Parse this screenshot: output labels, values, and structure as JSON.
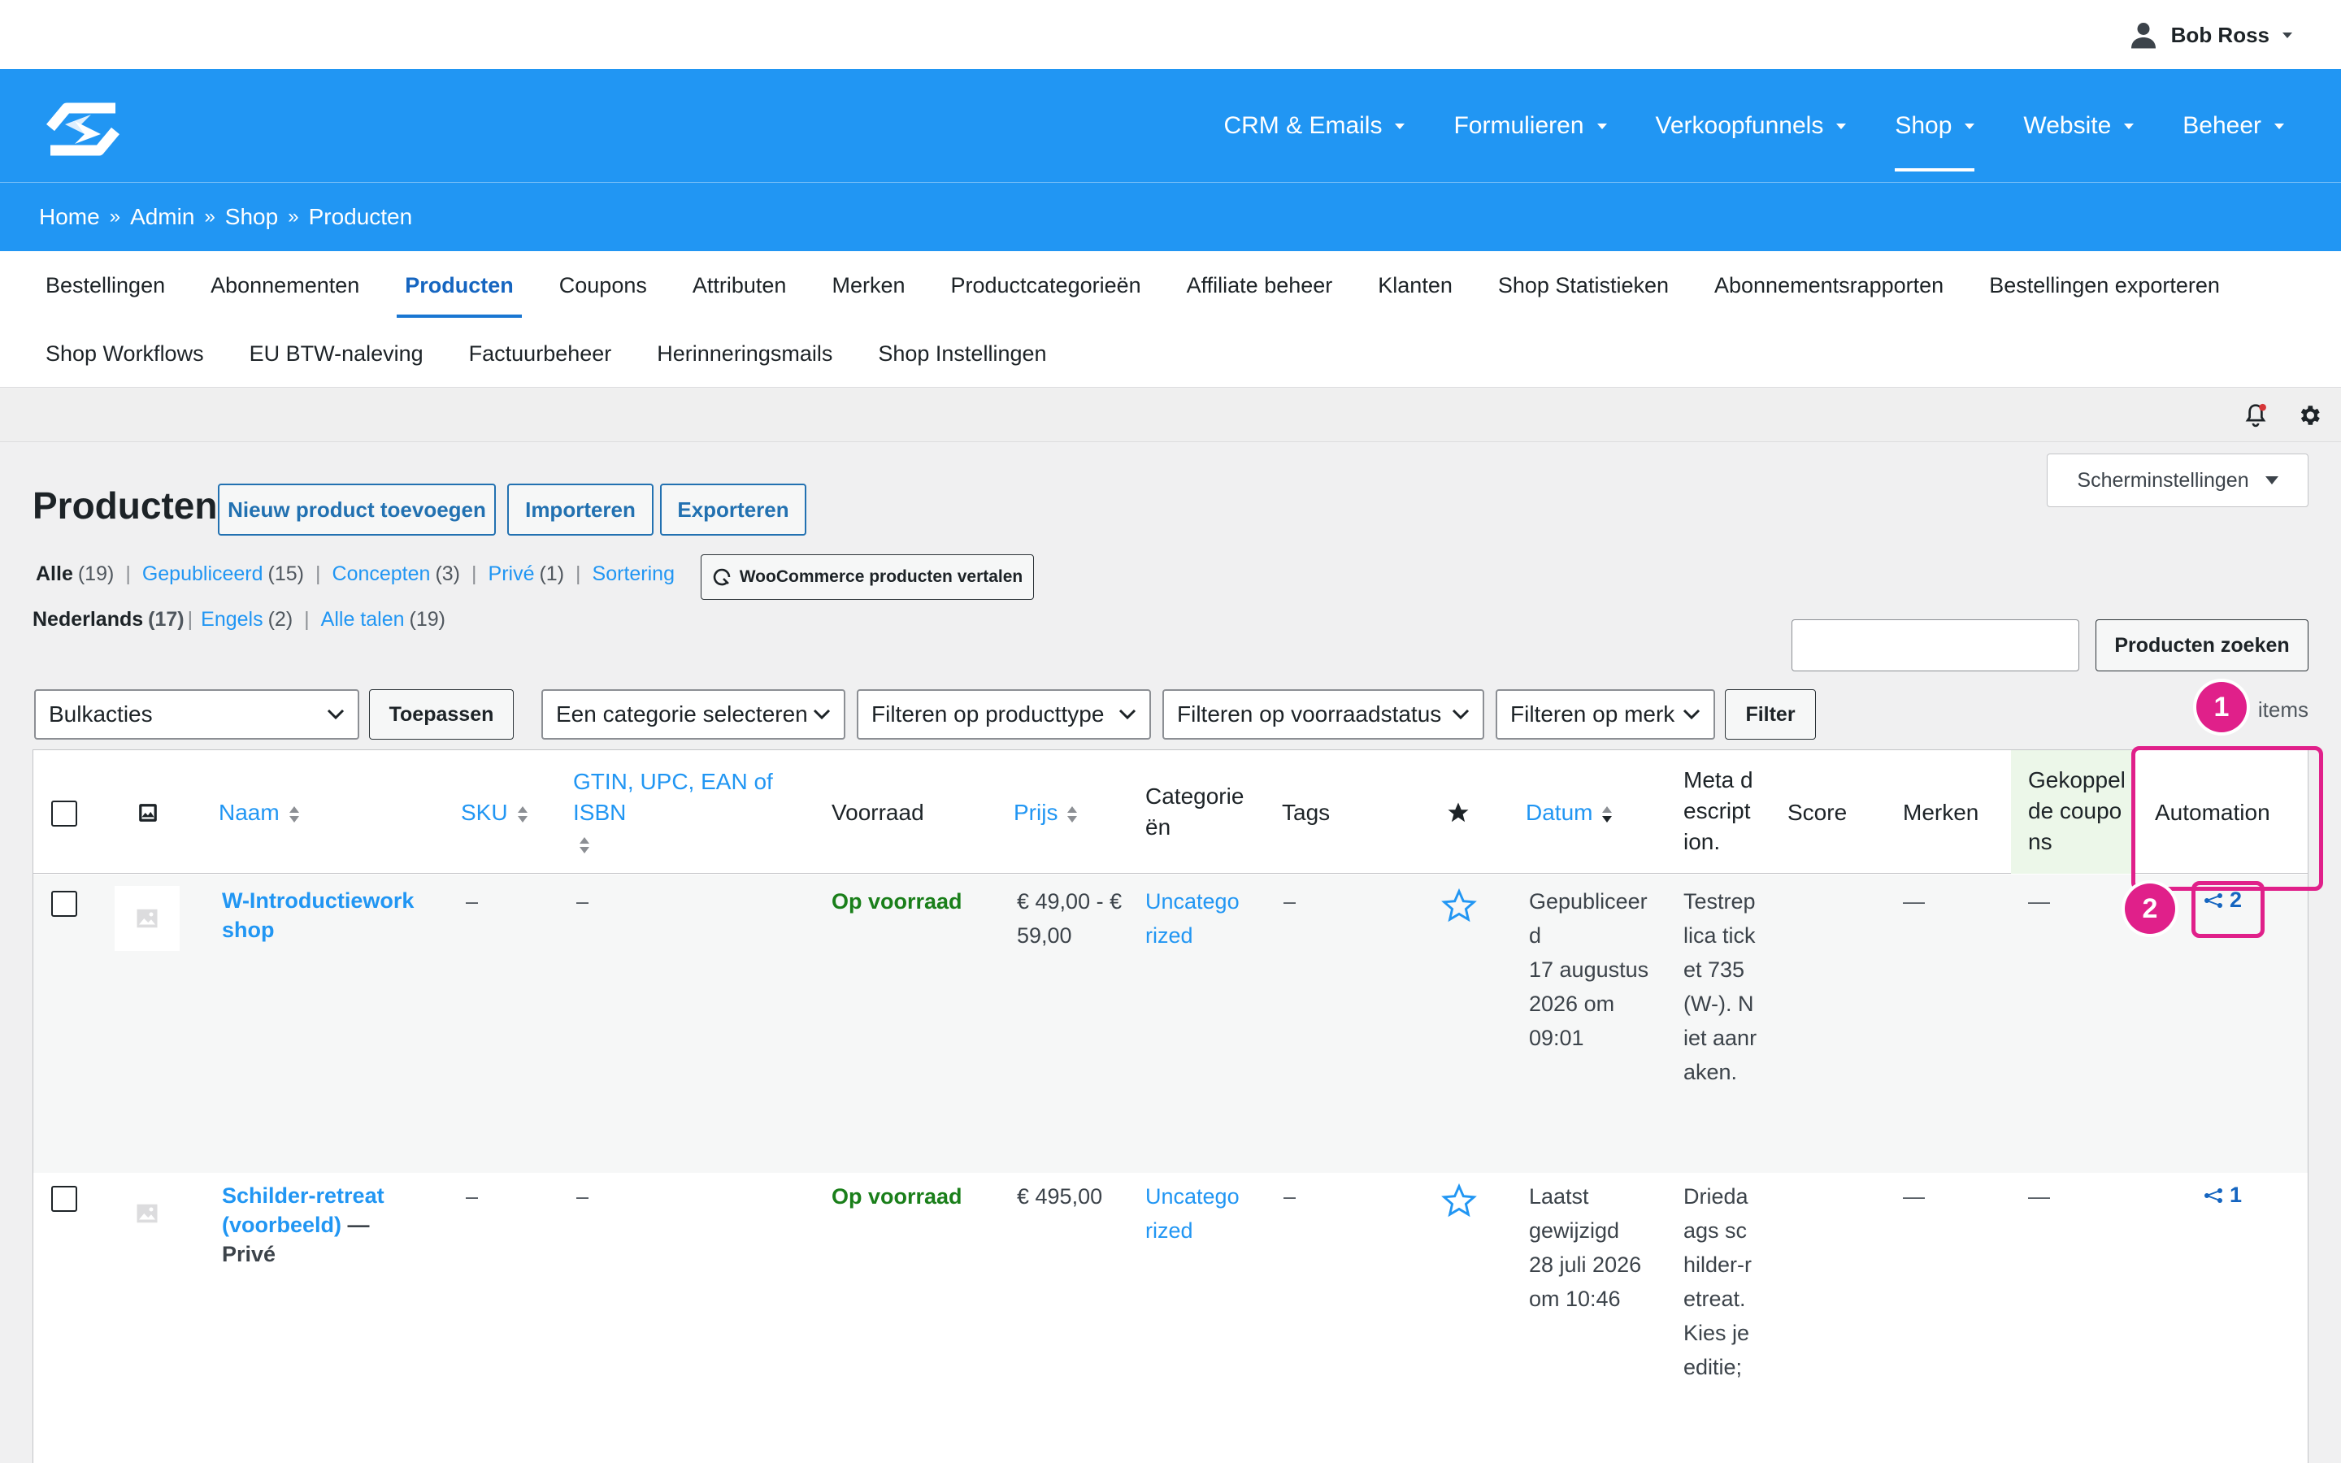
{
  "user": {
    "name": "Bob Ross"
  },
  "nav": {
    "items": [
      {
        "label": "CRM & Emails"
      },
      {
        "label": "Formulieren"
      },
      {
        "label": "Verkoopfunnels"
      },
      {
        "label": "Shop",
        "active": true
      },
      {
        "label": "Website"
      },
      {
        "label": "Beheer"
      }
    ]
  },
  "breadcrumb": {
    "items": [
      "Home",
      "Admin",
      "Shop",
      "Producten"
    ],
    "separator": "»"
  },
  "subnav": {
    "row1": [
      "Bestellingen",
      "Abonnementen",
      "Producten",
      "Coupons",
      "Attributen",
      "Merken",
      "Productcategorieën",
      "Affiliate beheer",
      "Klanten",
      "Shop Statistieken",
      "Abonnementsrapporten",
      "Bestellingen exporteren"
    ],
    "row2": [
      "Shop Workflows",
      "EU BTW-naleving",
      "Factuurbeheer",
      "Herinneringsmails",
      "Shop Instellingen"
    ],
    "active": "Producten"
  },
  "page": {
    "title": "Producten",
    "add_new": "Nieuw product toevoegen",
    "import": "Importeren",
    "export": "Exporteren",
    "screen_options": "Scherminstellingen"
  },
  "status_views": [
    {
      "label": "Alle",
      "count": "(19)",
      "current": true
    },
    {
      "label": "Gepubliceerd",
      "count": "(15)"
    },
    {
      "label": "Concepten",
      "count": "(3)"
    },
    {
      "label": "Privé",
      "count": "(1)"
    },
    {
      "label": "Sortering",
      "count": ""
    }
  ],
  "translate_button": "WooCommerce producten vertalen",
  "language_views": [
    {
      "label": "Nederlands",
      "count": "(17)",
      "current": true
    },
    {
      "label": "Engels",
      "count": "(2)"
    },
    {
      "label": "Alle talen",
      "count": "(19)"
    }
  ],
  "search": {
    "value": "",
    "button": "Producten zoeken"
  },
  "filters": {
    "bulk_actions": "Bulkacties",
    "apply": "Toepassen",
    "category": "Een categorie selecteren",
    "product_type": "Filteren op producttype",
    "stock_status": "Filteren op voorraadstatus",
    "brand": "Filteren op merk",
    "filter_button": "Filter",
    "items_text": "items"
  },
  "table": {
    "columns": {
      "name": "Naam",
      "sku": "SKU",
      "gtin": "GTIN, UPC, EAN of ISBN",
      "stock": "Voorraad",
      "price": "Prijs",
      "categories": "Categorieën",
      "tags": "Tags",
      "date": "Datum",
      "meta": "Meta description.",
      "score": "Score",
      "brands": "Merken",
      "coupons": "Gekoppelde coupons",
      "automation": "Automation"
    },
    "rows": [
      {
        "name": "W-Introductieworkshop",
        "suffix": "",
        "sku": "–",
        "gtin": "–",
        "stock": "Op voorraad",
        "price": "€ 49,00 - € 59,00",
        "category": "Uncategorized",
        "tags": "–",
        "date_status": "Gepubliceerd",
        "date": "17 augustus 2026 om 09:01",
        "meta": "Testreplica ticket 735 (W-). Niet aanraken.",
        "brands": "—",
        "coupons": "—",
        "automation": "2"
      },
      {
        "name": "Schilder-retreat (voorbeeld)",
        "suffix": "— Privé",
        "sku": "–",
        "gtin": "–",
        "stock": "Op voorraad",
        "price": "€ 495,00",
        "category": "Uncategorized",
        "tags": "–",
        "date_status": "Laatst gewijzigd",
        "date": "28 juli 2026 om 10:46",
        "meta": "Driedaags schilder-retreat. Kies je editie;",
        "brands": "—",
        "coupons": "—",
        "automation": "1"
      }
    ]
  },
  "callouts": [
    "1",
    "2"
  ],
  "colors": {
    "primary": "#2196f3",
    "highlight": "#e0208a",
    "in_stock": "#1a7f1a"
  }
}
